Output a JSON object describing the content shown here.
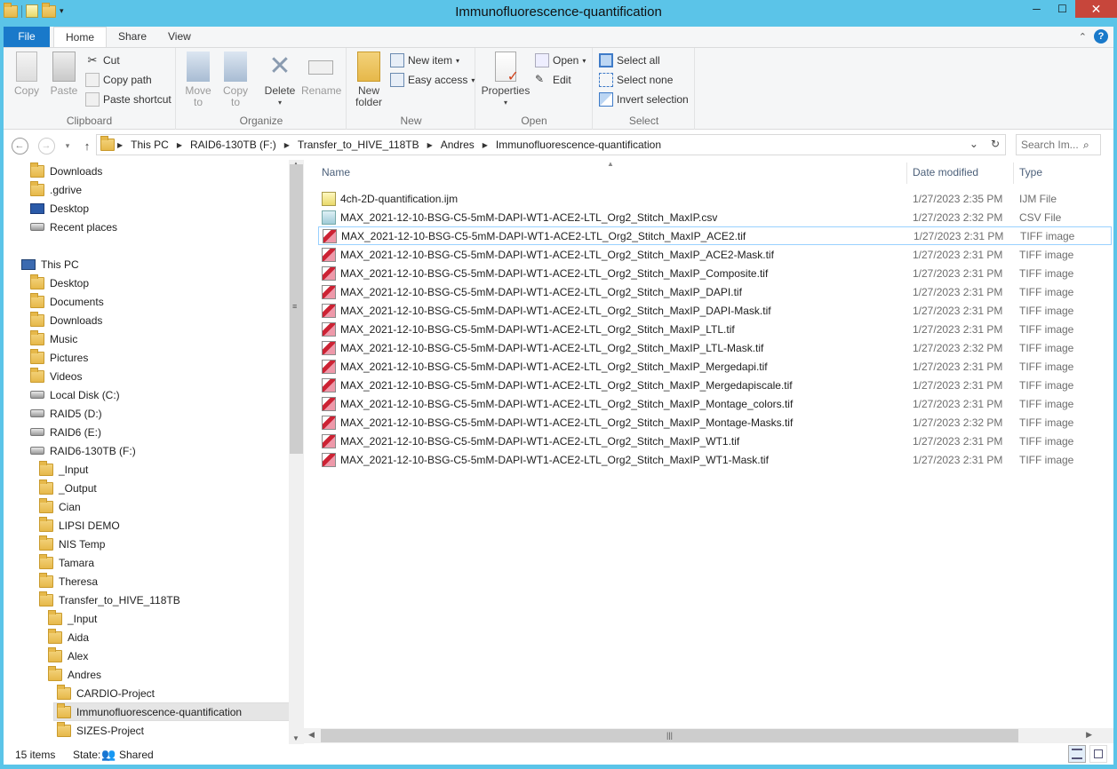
{
  "window": {
    "title": "Immunofluorescence-quantification",
    "min": "─",
    "max": "☐",
    "close": "✕"
  },
  "tabs": {
    "file": "File",
    "home": "Home",
    "share": "Share",
    "view": "View",
    "help": "?",
    "collapse": "⌃"
  },
  "ribbon": {
    "clipboard": {
      "label": "Clipboard",
      "copy": "Copy",
      "paste": "Paste",
      "cut": "Cut",
      "copy_path": "Copy path",
      "paste_shortcut": "Paste shortcut"
    },
    "organize": {
      "label": "Organize",
      "move_to_1": "Move",
      "move_to_2": "to",
      "copy_to_1": "Copy",
      "copy_to_2": "to",
      "delete": "Delete",
      "rename": "Rename"
    },
    "new": {
      "label": "New",
      "new_folder_1": "New",
      "new_folder_2": "folder",
      "new_item": "New item",
      "easy_access": "Easy access"
    },
    "open": {
      "label": "Open",
      "properties": "Properties",
      "open": "Open",
      "edit": "Edit"
    },
    "select": {
      "label": "Select",
      "select_all": "Select all",
      "select_none": "Select none",
      "invert": "Invert selection"
    }
  },
  "address": {
    "crumbs": [
      "This PC",
      "RAID6-130TB (F:)",
      "Transfer_to_HIVE_118TB",
      "Andres",
      "Immunofluorescence-quantification"
    ],
    "search_placeholder": "Search Im..."
  },
  "nav": [
    {
      "label": "Downloads",
      "icon": "folder-icon"
    },
    {
      "label": ".gdrive",
      "icon": "folder-icon"
    },
    {
      "label": "Desktop",
      "icon": "desktop-icon"
    },
    {
      "label": "Recent places",
      "icon": "recent-icon"
    },
    {
      "label": "This PC",
      "icon": "pc-icon"
    },
    {
      "label": "Desktop",
      "icon": "folder-icon"
    },
    {
      "label": "Documents",
      "icon": "folder-icon"
    },
    {
      "label": "Downloads",
      "icon": "folder-icon"
    },
    {
      "label": "Music",
      "icon": "folder-icon"
    },
    {
      "label": "Pictures",
      "icon": "folder-icon"
    },
    {
      "label": "Videos",
      "icon": "folder-icon"
    },
    {
      "label": "Local Disk (C:)",
      "icon": "drive-icon"
    },
    {
      "label": "RAID5 (D:)",
      "icon": "drive-icon"
    },
    {
      "label": "RAID6 (E:)",
      "icon": "drive-icon"
    },
    {
      "label": "RAID6-130TB (F:)",
      "icon": "drive-icon"
    },
    {
      "label": "_Input",
      "icon": "folder-icon"
    },
    {
      "label": "_Output",
      "icon": "folder-icon"
    },
    {
      "label": "Cian",
      "icon": "folder-icon"
    },
    {
      "label": "LIPSI DEMO",
      "icon": "folder-icon"
    },
    {
      "label": "NIS Temp",
      "icon": "folder-icon"
    },
    {
      "label": "Tamara",
      "icon": "folder-icon"
    },
    {
      "label": "Theresa",
      "icon": "folder-icon"
    },
    {
      "label": "Transfer_to_HIVE_118TB",
      "icon": "folder-icon"
    },
    {
      "label": "_Input",
      "icon": "folder-icon"
    },
    {
      "label": "Aida",
      "icon": "folder-icon"
    },
    {
      "label": "Alex",
      "icon": "folder-icon"
    },
    {
      "label": "Andres",
      "icon": "folder-icon"
    },
    {
      "label": "CARDIO-Project",
      "icon": "folder-icon"
    },
    {
      "label": "Immunofluorescence-quantification",
      "icon": "folder-icon"
    },
    {
      "label": "SIZES-Project",
      "icon": "folder-icon"
    }
  ],
  "columns": {
    "name": "Name",
    "date": "Date modified",
    "type": "Type"
  },
  "files": [
    {
      "name": "4ch-2D-quantification.ijm",
      "date": "1/27/2023 2:35 PM",
      "type": "IJM File",
      "icon": "ijm-file-icon"
    },
    {
      "name": "MAX_2021-12-10-BSG-C5-5mM-DAPI-WT1-ACE2-LTL_Org2_Stitch_MaxIP.csv",
      "date": "1/27/2023 2:32 PM",
      "type": "CSV File",
      "icon": "csv-file-icon"
    },
    {
      "name": "MAX_2021-12-10-BSG-C5-5mM-DAPI-WT1-ACE2-LTL_Org2_Stitch_MaxIP_ACE2.tif",
      "date": "1/27/2023 2:31 PM",
      "type": "TIFF image",
      "icon": "tiff-file-icon"
    },
    {
      "name": "MAX_2021-12-10-BSG-C5-5mM-DAPI-WT1-ACE2-LTL_Org2_Stitch_MaxIP_ACE2-Mask.tif",
      "date": "1/27/2023 2:31 PM",
      "type": "TIFF image",
      "icon": "tiff-file-icon"
    },
    {
      "name": "MAX_2021-12-10-BSG-C5-5mM-DAPI-WT1-ACE2-LTL_Org2_Stitch_MaxIP_Composite.tif",
      "date": "1/27/2023 2:31 PM",
      "type": "TIFF image",
      "icon": "tiff-file-icon"
    },
    {
      "name": "MAX_2021-12-10-BSG-C5-5mM-DAPI-WT1-ACE2-LTL_Org2_Stitch_MaxIP_DAPI.tif",
      "date": "1/27/2023 2:31 PM",
      "type": "TIFF image",
      "icon": "tiff-file-icon"
    },
    {
      "name": "MAX_2021-12-10-BSG-C5-5mM-DAPI-WT1-ACE2-LTL_Org2_Stitch_MaxIP_DAPI-Mask.tif",
      "date": "1/27/2023 2:31 PM",
      "type": "TIFF image",
      "icon": "tiff-file-icon"
    },
    {
      "name": "MAX_2021-12-10-BSG-C5-5mM-DAPI-WT1-ACE2-LTL_Org2_Stitch_MaxIP_LTL.tif",
      "date": "1/27/2023 2:31 PM",
      "type": "TIFF image",
      "icon": "tiff-file-icon"
    },
    {
      "name": "MAX_2021-12-10-BSG-C5-5mM-DAPI-WT1-ACE2-LTL_Org2_Stitch_MaxIP_LTL-Mask.tif",
      "date": "1/27/2023 2:32 PM",
      "type": "TIFF image",
      "icon": "tiff-file-icon"
    },
    {
      "name": "MAX_2021-12-10-BSG-C5-5mM-DAPI-WT1-ACE2-LTL_Org2_Stitch_MaxIP_Mergedapi.tif",
      "date": "1/27/2023 2:31 PM",
      "type": "TIFF image",
      "icon": "tiff-file-icon"
    },
    {
      "name": "MAX_2021-12-10-BSG-C5-5mM-DAPI-WT1-ACE2-LTL_Org2_Stitch_MaxIP_Mergedapiscale.tif",
      "date": "1/27/2023 2:31 PM",
      "type": "TIFF image",
      "icon": "tiff-file-icon"
    },
    {
      "name": "MAX_2021-12-10-BSG-C5-5mM-DAPI-WT1-ACE2-LTL_Org2_Stitch_MaxIP_Montage_colors.tif",
      "date": "1/27/2023 2:31 PM",
      "type": "TIFF image",
      "icon": "tiff-file-icon"
    },
    {
      "name": "MAX_2021-12-10-BSG-C5-5mM-DAPI-WT1-ACE2-LTL_Org2_Stitch_MaxIP_Montage-Masks.tif",
      "date": "1/27/2023 2:32 PM",
      "type": "TIFF image",
      "icon": "tiff-file-icon"
    },
    {
      "name": "MAX_2021-12-10-BSG-C5-5mM-DAPI-WT1-ACE2-LTL_Org2_Stitch_MaxIP_WT1.tif",
      "date": "1/27/2023 2:31 PM",
      "type": "TIFF image",
      "icon": "tiff-file-icon"
    },
    {
      "name": "MAX_2021-12-10-BSG-C5-5mM-DAPI-WT1-ACE2-LTL_Org2_Stitch_MaxIP_WT1-Mask.tif",
      "date": "1/27/2023 2:31 PM",
      "type": "TIFF image",
      "icon": "tiff-file-icon"
    }
  ],
  "status": {
    "count": "15 items",
    "state_label": "State:",
    "state_value": "Shared"
  },
  "colors": {
    "title_bar": "#5bc4e8",
    "file_tab": "#1979ca",
    "close_button": "#c7463b",
    "selection_border": "#99d1ff"
  }
}
